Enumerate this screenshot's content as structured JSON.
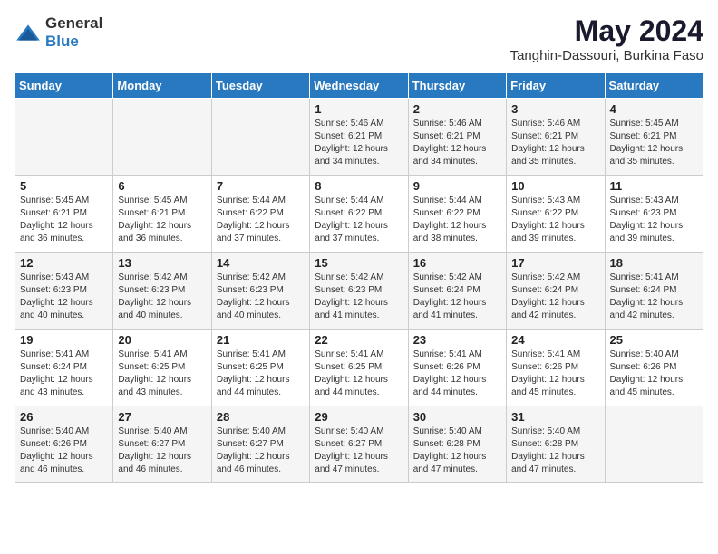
{
  "logo": {
    "text_general": "General",
    "text_blue": "Blue"
  },
  "title": "May 2024",
  "subtitle": "Tanghin-Dassouri, Burkina Faso",
  "days_of_week": [
    "Sunday",
    "Monday",
    "Tuesday",
    "Wednesday",
    "Thursday",
    "Friday",
    "Saturday"
  ],
  "weeks": [
    [
      {
        "day": "",
        "info": ""
      },
      {
        "day": "",
        "info": ""
      },
      {
        "day": "",
        "info": ""
      },
      {
        "day": "1",
        "info": "Sunrise: 5:46 AM\nSunset: 6:21 PM\nDaylight: 12 hours\nand 34 minutes."
      },
      {
        "day": "2",
        "info": "Sunrise: 5:46 AM\nSunset: 6:21 PM\nDaylight: 12 hours\nand 34 minutes."
      },
      {
        "day": "3",
        "info": "Sunrise: 5:46 AM\nSunset: 6:21 PM\nDaylight: 12 hours\nand 35 minutes."
      },
      {
        "day": "4",
        "info": "Sunrise: 5:45 AM\nSunset: 6:21 PM\nDaylight: 12 hours\nand 35 minutes."
      }
    ],
    [
      {
        "day": "5",
        "info": "Sunrise: 5:45 AM\nSunset: 6:21 PM\nDaylight: 12 hours\nand 36 minutes."
      },
      {
        "day": "6",
        "info": "Sunrise: 5:45 AM\nSunset: 6:21 PM\nDaylight: 12 hours\nand 36 minutes."
      },
      {
        "day": "7",
        "info": "Sunrise: 5:44 AM\nSunset: 6:22 PM\nDaylight: 12 hours\nand 37 minutes."
      },
      {
        "day": "8",
        "info": "Sunrise: 5:44 AM\nSunset: 6:22 PM\nDaylight: 12 hours\nand 37 minutes."
      },
      {
        "day": "9",
        "info": "Sunrise: 5:44 AM\nSunset: 6:22 PM\nDaylight: 12 hours\nand 38 minutes."
      },
      {
        "day": "10",
        "info": "Sunrise: 5:43 AM\nSunset: 6:22 PM\nDaylight: 12 hours\nand 39 minutes."
      },
      {
        "day": "11",
        "info": "Sunrise: 5:43 AM\nSunset: 6:23 PM\nDaylight: 12 hours\nand 39 minutes."
      }
    ],
    [
      {
        "day": "12",
        "info": "Sunrise: 5:43 AM\nSunset: 6:23 PM\nDaylight: 12 hours\nand 40 minutes."
      },
      {
        "day": "13",
        "info": "Sunrise: 5:42 AM\nSunset: 6:23 PM\nDaylight: 12 hours\nand 40 minutes."
      },
      {
        "day": "14",
        "info": "Sunrise: 5:42 AM\nSunset: 6:23 PM\nDaylight: 12 hours\nand 40 minutes."
      },
      {
        "day": "15",
        "info": "Sunrise: 5:42 AM\nSunset: 6:23 PM\nDaylight: 12 hours\nand 41 minutes."
      },
      {
        "day": "16",
        "info": "Sunrise: 5:42 AM\nSunset: 6:24 PM\nDaylight: 12 hours\nand 41 minutes."
      },
      {
        "day": "17",
        "info": "Sunrise: 5:42 AM\nSunset: 6:24 PM\nDaylight: 12 hours\nand 42 minutes."
      },
      {
        "day": "18",
        "info": "Sunrise: 5:41 AM\nSunset: 6:24 PM\nDaylight: 12 hours\nand 42 minutes."
      }
    ],
    [
      {
        "day": "19",
        "info": "Sunrise: 5:41 AM\nSunset: 6:24 PM\nDaylight: 12 hours\nand 43 minutes."
      },
      {
        "day": "20",
        "info": "Sunrise: 5:41 AM\nSunset: 6:25 PM\nDaylight: 12 hours\nand 43 minutes."
      },
      {
        "day": "21",
        "info": "Sunrise: 5:41 AM\nSunset: 6:25 PM\nDaylight: 12 hours\nand 44 minutes."
      },
      {
        "day": "22",
        "info": "Sunrise: 5:41 AM\nSunset: 6:25 PM\nDaylight: 12 hours\nand 44 minutes."
      },
      {
        "day": "23",
        "info": "Sunrise: 5:41 AM\nSunset: 6:26 PM\nDaylight: 12 hours\nand 44 minutes."
      },
      {
        "day": "24",
        "info": "Sunrise: 5:41 AM\nSunset: 6:26 PM\nDaylight: 12 hours\nand 45 minutes."
      },
      {
        "day": "25",
        "info": "Sunrise: 5:40 AM\nSunset: 6:26 PM\nDaylight: 12 hours\nand 45 minutes."
      }
    ],
    [
      {
        "day": "26",
        "info": "Sunrise: 5:40 AM\nSunset: 6:26 PM\nDaylight: 12 hours\nand 46 minutes."
      },
      {
        "day": "27",
        "info": "Sunrise: 5:40 AM\nSunset: 6:27 PM\nDaylight: 12 hours\nand 46 minutes."
      },
      {
        "day": "28",
        "info": "Sunrise: 5:40 AM\nSunset: 6:27 PM\nDaylight: 12 hours\nand 46 minutes."
      },
      {
        "day": "29",
        "info": "Sunrise: 5:40 AM\nSunset: 6:27 PM\nDaylight: 12 hours\nand 47 minutes."
      },
      {
        "day": "30",
        "info": "Sunrise: 5:40 AM\nSunset: 6:28 PM\nDaylight: 12 hours\nand 47 minutes."
      },
      {
        "day": "31",
        "info": "Sunrise: 5:40 AM\nSunset: 6:28 PM\nDaylight: 12 hours\nand 47 minutes."
      },
      {
        "day": "",
        "info": ""
      }
    ]
  ]
}
